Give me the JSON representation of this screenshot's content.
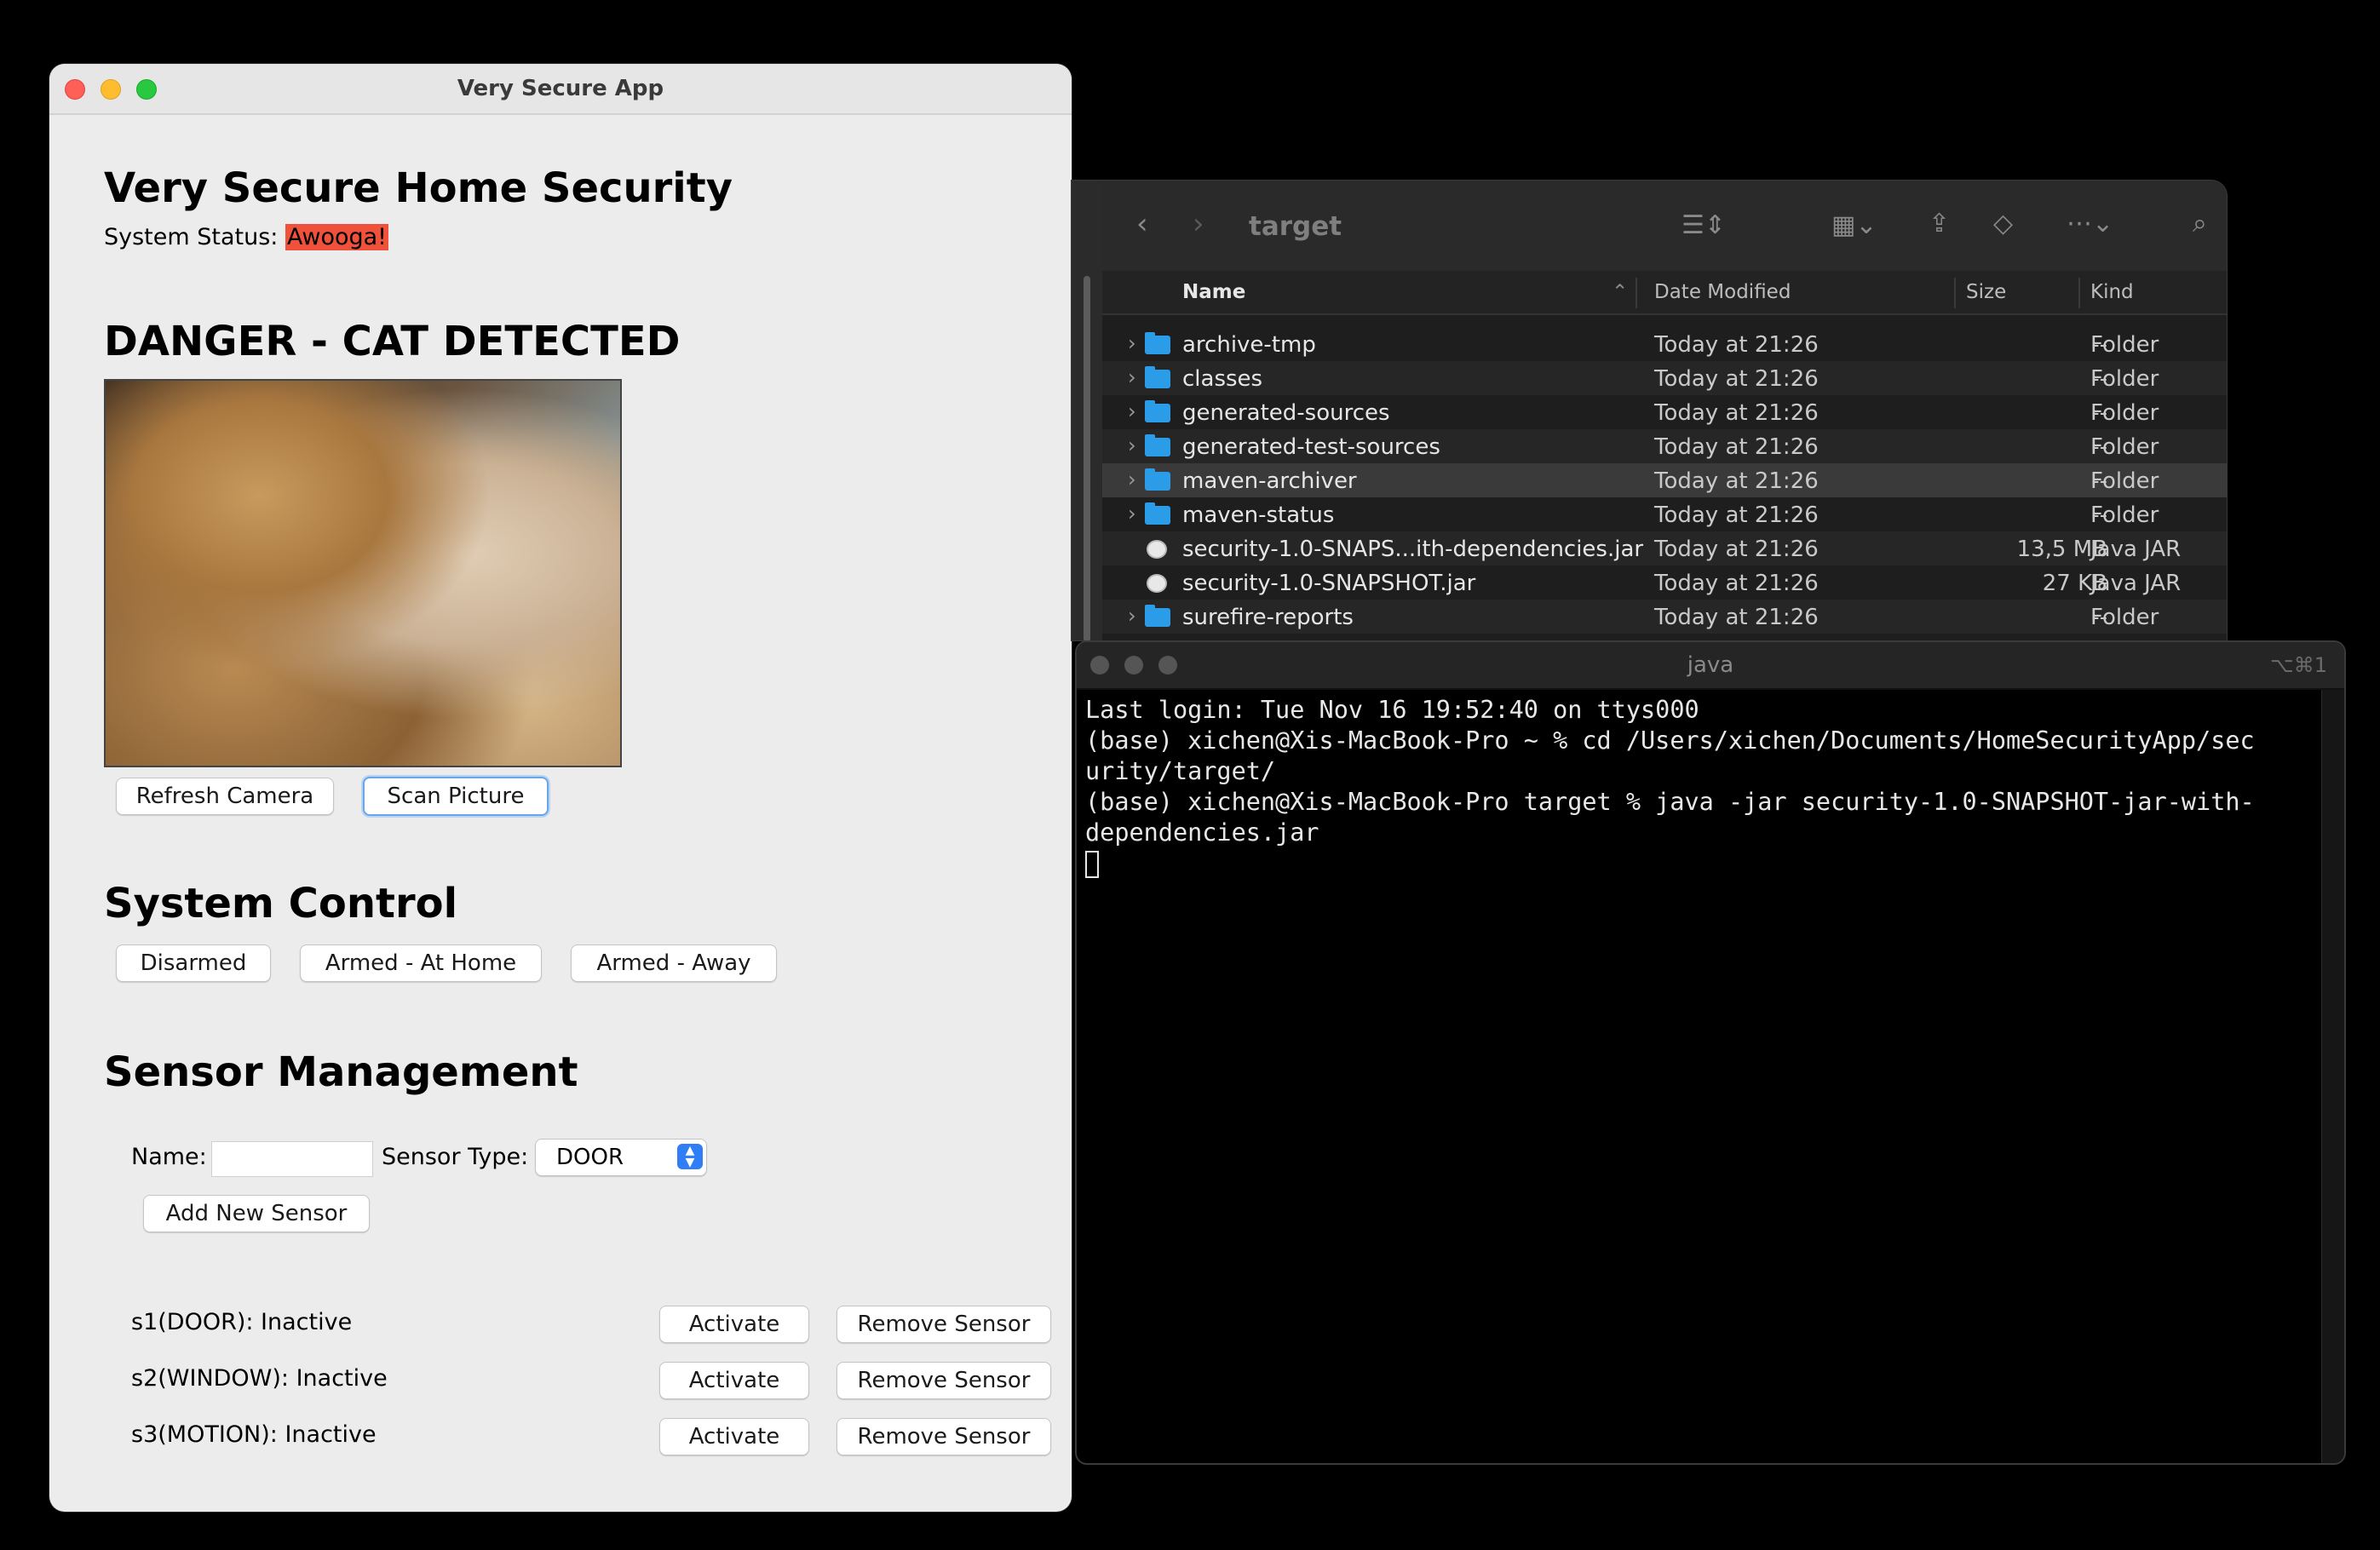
{
  "app": {
    "window_title": "Very Secure App",
    "heading": "Very Secure Home Security",
    "status_label": "System Status:",
    "status_value": "Awooga!",
    "status_color": "#f0513a",
    "alert_heading": "DANGER - CAT DETECTED",
    "camera_buttons": {
      "refresh": "Refresh Camera",
      "scan": "Scan Picture"
    },
    "control_heading": "System Control",
    "control_buttons": {
      "disarmed": "Disarmed",
      "armed_home": "Armed - At Home",
      "armed_away": "Armed - Away"
    },
    "sensor_heading": "Sensor Management",
    "name_label": "Name:",
    "name_value": "",
    "type_label": "Sensor Type:",
    "type_value": "DOOR",
    "add_button": "Add New Sensor",
    "sensors": [
      {
        "label": "s1(DOOR): Inactive",
        "activate": "Activate",
        "remove": "Remove Sensor"
      },
      {
        "label": "s2(WINDOW): Inactive",
        "activate": "Activate",
        "remove": "Remove Sensor"
      },
      {
        "label": "s3(MOTION): Inactive",
        "activate": "Activate",
        "remove": "Remove Sensor"
      }
    ]
  },
  "finder": {
    "title": "target",
    "columns": {
      "name": "Name",
      "date": "Date Modified",
      "size": "Size",
      "kind": "Kind"
    },
    "rows": [
      {
        "name": "archive-tmp",
        "date": "Today at 21:26",
        "size": "--",
        "kind": "Folder",
        "type": "folder"
      },
      {
        "name": "classes",
        "date": "Today at 21:26",
        "size": "--",
        "kind": "Folder",
        "type": "folder"
      },
      {
        "name": "generated-sources",
        "date": "Today at 21:26",
        "size": "--",
        "kind": "Folder",
        "type": "folder"
      },
      {
        "name": "generated-test-sources",
        "date": "Today at 21:26",
        "size": "--",
        "kind": "Folder",
        "type": "folder"
      },
      {
        "name": "maven-archiver",
        "date": "Today at 21:26",
        "size": "--",
        "kind": "Folder",
        "type": "folder"
      },
      {
        "name": "maven-status",
        "date": "Today at 21:26",
        "size": "--",
        "kind": "Folder",
        "type": "folder"
      },
      {
        "name": "security-1.0-SNAPS...ith-dependencies.jar",
        "date": "Today at 21:26",
        "size": "13,5 MB",
        "kind": "Java JAR",
        "type": "jar"
      },
      {
        "name": "security-1.0-SNAPSHOT.jar",
        "date": "Today at 21:26",
        "size": "27 KB",
        "kind": "Java JAR",
        "type": "jar"
      },
      {
        "name": "surefire-reports",
        "date": "Today at 21:26",
        "size": "--",
        "kind": "Folder",
        "type": "folder"
      }
    ]
  },
  "terminal": {
    "title": "java",
    "shortcut": "⌥⌘1",
    "lines": [
      "Last login: Tue Nov 16 19:52:40 on ttys000",
      "(base) xichen@Xis-MacBook-Pro ~ % cd /Users/xichen/Documents/HomeSecurityApp/sec",
      "urity/target/",
      "(base) xichen@Xis-MacBook-Pro target % java -jar security-1.0-SNAPSHOT-jar-with-",
      "dependencies.jar"
    ]
  }
}
